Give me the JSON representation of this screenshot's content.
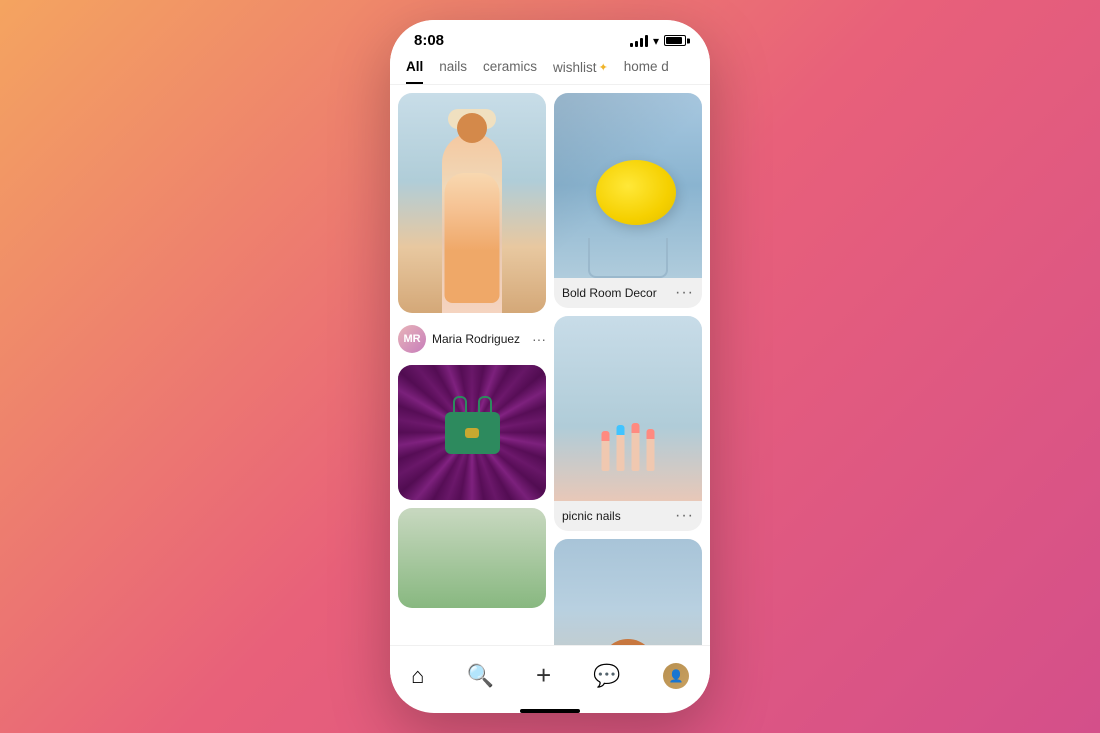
{
  "phone": {
    "status_bar": {
      "time": "8:08"
    },
    "tabs": [
      {
        "label": "All",
        "active": true
      },
      {
        "label": "nails",
        "active": false
      },
      {
        "label": "ceramics",
        "active": false
      },
      {
        "label": "wishlist ✦",
        "active": false
      },
      {
        "label": "home d",
        "active": false
      }
    ],
    "pins": {
      "left_column": [
        {
          "id": "fashion",
          "type": "image",
          "height": "tall"
        },
        {
          "id": "user-row",
          "username": "Maria Rodriguez",
          "dots": "···"
        },
        {
          "id": "velvet-bag",
          "type": "image",
          "height": "medium"
        },
        {
          "id": "partial",
          "type": "image",
          "height": "short"
        }
      ],
      "right_column": [
        {
          "id": "yellow-bag",
          "type": "image",
          "label": "Bold Room Decor",
          "dots": "···"
        },
        {
          "id": "nails",
          "type": "image",
          "label": "picnic nails",
          "dots": "···"
        },
        {
          "id": "portrait",
          "type": "image",
          "height": "tall"
        }
      ]
    },
    "bottom_nav": [
      {
        "id": "home",
        "icon": "⌂",
        "active": true
      },
      {
        "id": "search",
        "icon": "⌕",
        "active": false
      },
      {
        "id": "add",
        "icon": "+",
        "active": false
      },
      {
        "id": "messages",
        "icon": "💬",
        "active": false
      },
      {
        "id": "profile",
        "icon": "👤",
        "active": false
      }
    ]
  }
}
